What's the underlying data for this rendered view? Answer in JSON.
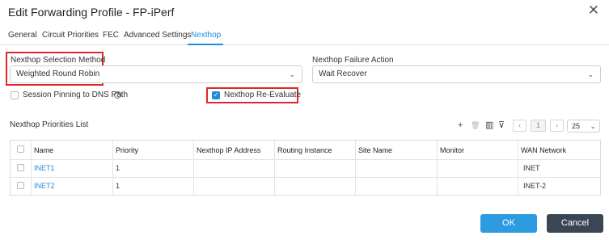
{
  "dialog": {
    "title": "Edit Forwarding Profile - FP-iPerf",
    "close_symbol": "✕"
  },
  "tabs": [
    {
      "label": "General"
    },
    {
      "label": "Circuit Priorities"
    },
    {
      "label": "FEC"
    },
    {
      "label": "Advanced Settings"
    },
    {
      "label": "Nexthop",
      "active": true
    }
  ],
  "form": {
    "selection_method_label": "Nexthop Selection Method",
    "selection_method_value": "Weighted Round Robin",
    "failure_action_label": "Nexthop Failure Action",
    "failure_action_value": "Wait Recover",
    "session_pinning_label": "Session Pinning to DNS Path",
    "session_pinning_checked": false,
    "reevaluate_label": "Nexthop Re-Evaluate",
    "reevaluate_checked": true,
    "caret": "⌄",
    "check_mark": "✓",
    "info_symbol": "?"
  },
  "list": {
    "title": "Nexthop Priorities List",
    "toolbar": {
      "add": "+",
      "delete": "🗑",
      "columns": "▥",
      "filter": "⊽"
    },
    "pagination": {
      "prev": "‹",
      "page": "1",
      "next": "›",
      "page_size": "25"
    },
    "columns": [
      "Name",
      "Priority",
      "Nexthop IP Address",
      "Routing Instance",
      "Site Name",
      "Monitor",
      "WAN Network"
    ],
    "rows": [
      {
        "name": "INET1",
        "priority": "1",
        "ip": "",
        "routing": "",
        "site": "",
        "monitor": "",
        "wan": "INET"
      },
      {
        "name": "INET2",
        "priority": "1",
        "ip": "",
        "routing": "",
        "site": "",
        "monitor": "",
        "wan": "INET-2"
      }
    ]
  },
  "footer": {
    "ok_label": "OK",
    "cancel_label": "Cancel"
  },
  "colors": {
    "accent": "#1a8fd6",
    "highlight": "#e0262b",
    "ok_button": "#2d9be0",
    "cancel_button": "#3b4654"
  }
}
